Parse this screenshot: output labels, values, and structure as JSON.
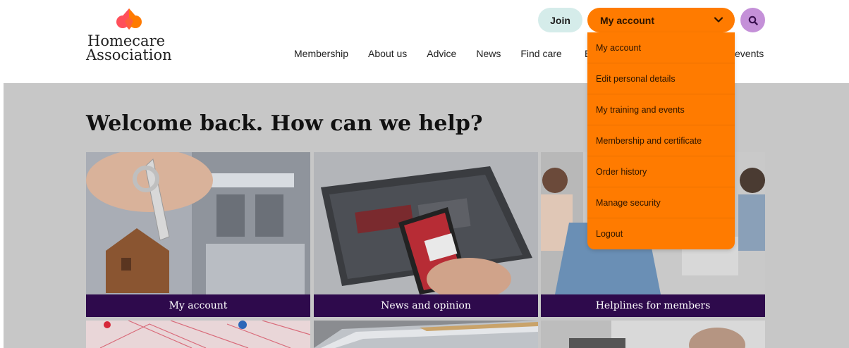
{
  "brand": {
    "line1": "Homecare",
    "line2": "Association",
    "colors": {
      "orange": "#ff7b00",
      "coral": "#ff4f5a",
      "purple": "#2e0a4c",
      "teal": "#d5ecea",
      "lilac": "#c490d8"
    }
  },
  "header": {
    "join_label": "Join",
    "account_label": "My account",
    "account_icon": "chevron-down-icon",
    "search_icon": "search-icon"
  },
  "nav": {
    "items": [
      "Membership",
      "About us",
      "Advice",
      "News",
      "Find care"
    ],
    "partial_left": "E",
    "partial_right": "events"
  },
  "main": {
    "heading": "Welcome back. How can we help?",
    "cards": [
      {
        "caption": "My account"
      },
      {
        "caption": "News and opinion"
      },
      {
        "caption": "Helplines for members"
      }
    ]
  },
  "dropdown": {
    "items": [
      "My account",
      "Edit personal details",
      "My training and events",
      "Membership and certificate",
      "Order history",
      "Manage security",
      "Logout"
    ]
  }
}
